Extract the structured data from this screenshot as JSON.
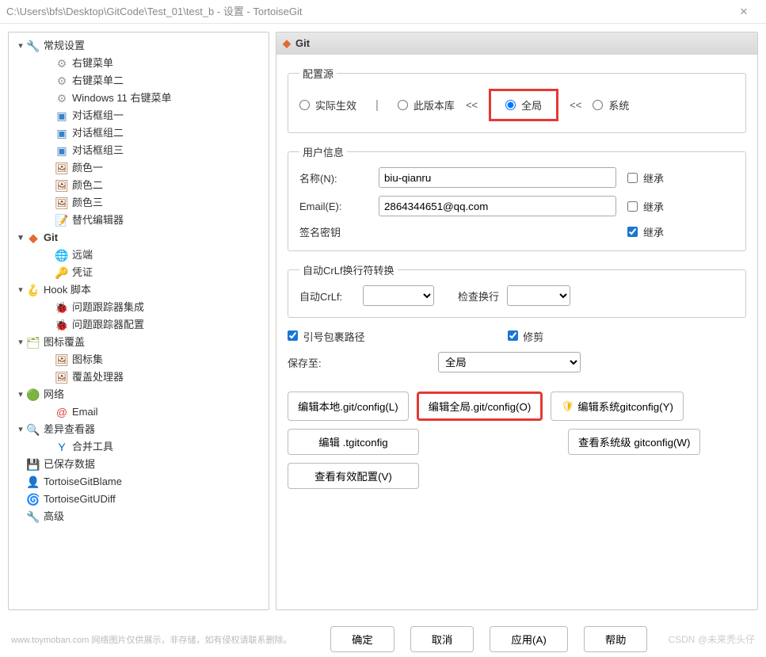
{
  "window": {
    "title": "C:\\Users\\bfs\\Desktop\\GitCode\\Test_01\\test_b - 设置 - TortoiseGit"
  },
  "tree": [
    {
      "level": 0,
      "exp": "v",
      "icon": "🔧",
      "iconClass": "ico-wrench",
      "iconName": "wrench-icon",
      "label": "常规设置"
    },
    {
      "level": 1,
      "icon": "⚙",
      "iconClass": "ico-gear",
      "iconName": "gear-icon",
      "label": "右键菜单"
    },
    {
      "level": 1,
      "icon": "⚙",
      "iconClass": "ico-gear",
      "iconName": "gear-icon",
      "label": "右键菜单二"
    },
    {
      "level": 1,
      "icon": "⚙",
      "iconClass": "ico-gear",
      "iconName": "gear-icon",
      "label": "Windows 11 右键菜单"
    },
    {
      "level": 1,
      "icon": "▣",
      "iconClass": "ico-win",
      "iconName": "windows-icon",
      "label": "对话框组一"
    },
    {
      "level": 1,
      "icon": "▣",
      "iconClass": "ico-win",
      "iconName": "windows-icon",
      "label": "对话框组二"
    },
    {
      "level": 1,
      "icon": "▣",
      "iconClass": "ico-win",
      "iconName": "windows-icon",
      "label": "对话框组三"
    },
    {
      "level": 1,
      "icon": "🖼",
      "iconClass": "ico-color",
      "iconName": "palette-icon",
      "label": "颜色一"
    },
    {
      "level": 1,
      "icon": "🖼",
      "iconClass": "ico-color",
      "iconName": "palette-icon",
      "label": "颜色二"
    },
    {
      "level": 1,
      "icon": "🖼",
      "iconClass": "ico-color",
      "iconName": "palette-icon",
      "label": "颜色三"
    },
    {
      "level": 1,
      "icon": "📝",
      "iconClass": "ico-edit",
      "iconName": "editor-icon",
      "label": "替代编辑器"
    },
    {
      "level": 0,
      "exp": "v",
      "icon": "◆",
      "iconClass": "ico-git",
      "iconName": "git-icon",
      "label": "Git",
      "selected": true
    },
    {
      "level": 1,
      "icon": "🌐",
      "iconClass": "ico-globe",
      "iconName": "globe-icon",
      "label": "远端"
    },
    {
      "level": 1,
      "icon": "🔑",
      "iconClass": "ico-cred",
      "iconName": "credential-icon",
      "label": "凭证"
    },
    {
      "level": 0,
      "exp": "v",
      "icon": "🪝",
      "iconClass": "ico-hook",
      "iconName": "hook-icon",
      "label": "Hook 脚本"
    },
    {
      "level": 1,
      "icon": "🐞",
      "iconClass": "ico-bug",
      "iconName": "bug-icon",
      "label": "问题跟踪器集成"
    },
    {
      "level": 1,
      "icon": "🐞",
      "iconClass": "ico-bug",
      "iconName": "bug-icon",
      "label": "问题跟踪器配置"
    },
    {
      "level": 0,
      "exp": "v",
      "icon": "🗂",
      "iconClass": "ico-overlay",
      "iconName": "overlay-icon",
      "label": "图标覆盖"
    },
    {
      "level": 1,
      "icon": "🖼",
      "iconClass": "ico-color",
      "iconName": "iconset-icon",
      "label": "图标集"
    },
    {
      "level": 1,
      "icon": "🖼",
      "iconClass": "ico-color",
      "iconName": "handler-icon",
      "label": "覆盖处理器"
    },
    {
      "level": 0,
      "exp": "v",
      "icon": "🟢",
      "iconClass": "ico-net",
      "iconName": "network-icon",
      "label": "网络"
    },
    {
      "level": 1,
      "icon": "@",
      "iconClass": "ico-at",
      "iconName": "at-icon",
      "label": "Email"
    },
    {
      "level": 0,
      "exp": "v",
      "icon": "🔍",
      "iconClass": "ico-search",
      "iconName": "search-icon",
      "label": "差异查看器"
    },
    {
      "level": 1,
      "icon": "Y",
      "iconClass": "ico-merge",
      "iconName": "merge-icon",
      "label": "合并工具"
    },
    {
      "level": 0,
      "icon": "💾",
      "iconClass": "ico-save",
      "iconName": "save-icon",
      "label": "已保存数据"
    },
    {
      "level": 0,
      "icon": "👤",
      "iconClass": "ico-blame",
      "iconName": "blame-icon",
      "label": "TortoiseGitBlame"
    },
    {
      "level": 0,
      "icon": "🌀",
      "iconClass": "ico-diff",
      "iconName": "udiff-icon",
      "label": "TortoiseGitUDiff"
    },
    {
      "level": 0,
      "icon": "🔧",
      "iconClass": "ico-wrench",
      "iconName": "wrench-icon",
      "label": "高级"
    }
  ],
  "content": {
    "header": "Git",
    "configSource": {
      "legend": "配置源",
      "effective": "实际生效",
      "local": "此版本库",
      "global": "全局",
      "system": "系统",
      "selected": "global"
    },
    "userInfo": {
      "legend": "用户信息",
      "nameLabel": "名称(N):",
      "nameValue": "biu-qianru",
      "emailLabel": "Email(E):",
      "emailValue": "2864344651@qq.com",
      "signLabel": "签名密钥",
      "inheritLabel": "继承",
      "nameInherit": false,
      "emailInherit": false,
      "signInherit": true
    },
    "crlf": {
      "legend": "自动CrLf换行符转换",
      "autoLabel": "自动CrLf:",
      "checkLabel": "检查换行"
    },
    "quotePath": {
      "label": "引号包裹路径",
      "checked": true
    },
    "prune": {
      "label": "修剪",
      "checked": true
    },
    "saveTo": {
      "label": "保存至:",
      "value": "全局"
    },
    "buttons": {
      "editLocal": "编辑本地.git/config(L)",
      "editGlobal": "编辑全局.git/config(O)",
      "editSystem": "编辑系统gitconfig(Y)",
      "editTgit": "编辑 .tgitconfig",
      "viewSystem": "查看系统级 gitconfig(W)",
      "viewEffective": "查看有效配置(V)"
    }
  },
  "footer": {
    "watermark": "www.toymoban.com 网络图片仅供展示，非存储，如有侵权请联系删除。",
    "ok": "确定",
    "cancel": "取消",
    "apply": "应用(A)",
    "help": "帮助",
    "csdn": "CSDN @未来秃头仔"
  }
}
